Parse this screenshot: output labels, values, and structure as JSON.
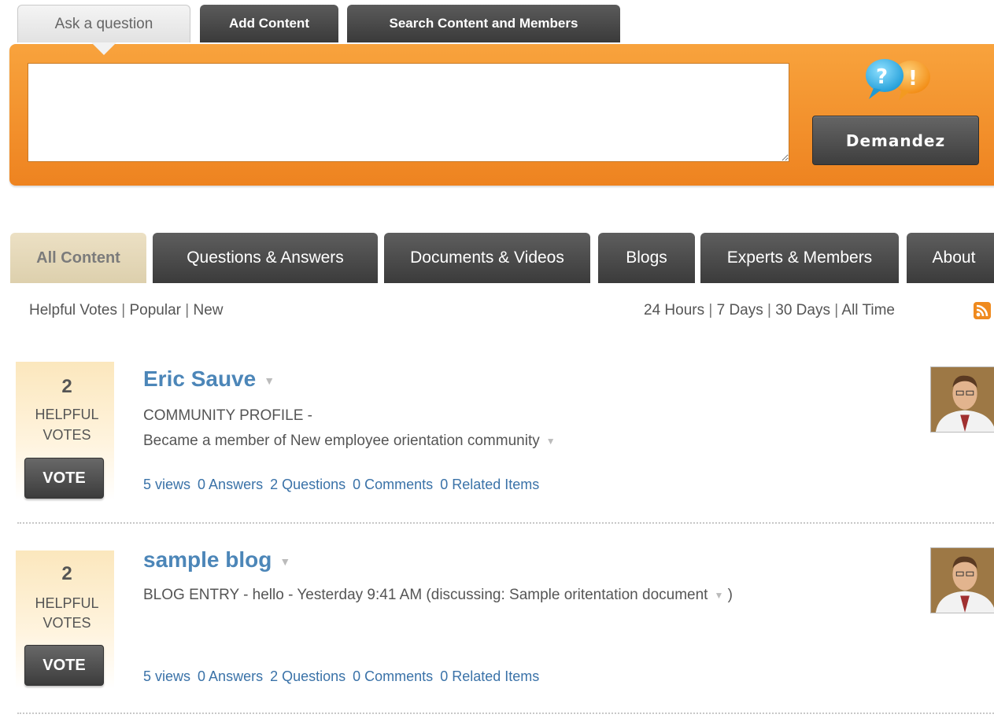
{
  "top_tabs": {
    "ask": "Ask a question",
    "add": "Add Content",
    "search": "Search Content and Members"
  },
  "ask_panel": {
    "input_value": "",
    "button_label": "Demandez",
    "icon": "question-exclamation-bubbles-icon"
  },
  "category_tabs": [
    "All Content",
    "Questions & Answers",
    "Documents & Videos",
    "Blogs",
    "Experts & Members",
    "About"
  ],
  "sort": {
    "by": [
      "Helpful Votes",
      "Popular",
      "New"
    ],
    "time": [
      "24 Hours",
      "7 Days",
      "30 Days",
      "All Time"
    ],
    "rss_icon": "rss-feed-icon"
  },
  "items": [
    {
      "votes": "2",
      "votes_label_1": "HELPFUL",
      "votes_label_2": "VOTES",
      "vote_button": "VOTE",
      "title": "Eric Sauve",
      "line1": "COMMUNITY PROFILE -",
      "line2": "Became a member of New employee orientation community",
      "stats": {
        "views": "5 views",
        "answers": "0 Answers",
        "questions": "2 Questions",
        "comments": "0 Comments",
        "related": "0 Related Items"
      }
    },
    {
      "votes": "2",
      "votes_label_1": "HELPFUL",
      "votes_label_2": "VOTES",
      "vote_button": "VOTE",
      "title": "sample blog",
      "line1_prefix": "BLOG ENTRY - hello - Yesterday 9:41 AM (discussing: Sample oritentation document",
      "line1_suffix": ")",
      "stats": {
        "views": "5 views",
        "answers": "0 Answers",
        "questions": "2 Questions",
        "comments": "0 Comments",
        "related": "0 Related Items"
      }
    }
  ],
  "colors": {
    "orange_panel": "#f39128",
    "link_blue": "#3a72a8",
    "title_blue": "#4c86b8",
    "dark_tab": "#4a4a4a",
    "active_tab": "#e5d8b8"
  }
}
